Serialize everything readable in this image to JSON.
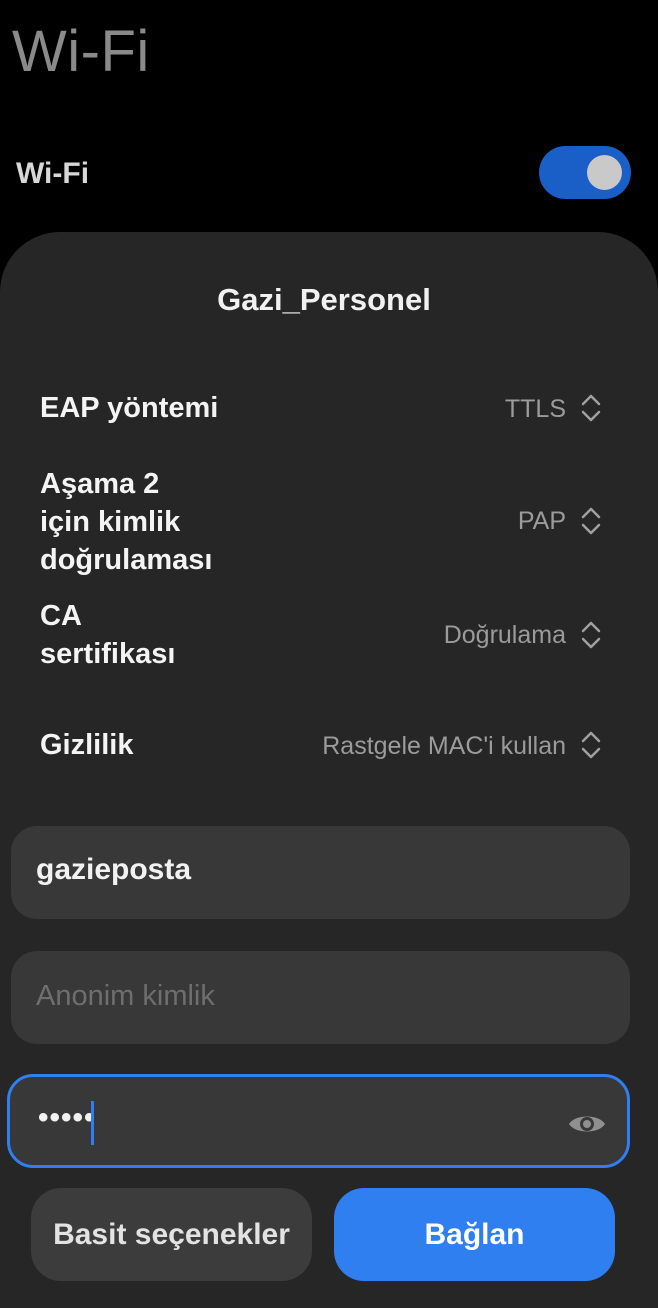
{
  "header": {
    "title": "Wi-Fi",
    "wifi_toggle_label": "Wi-Fi",
    "wifi_enabled": true
  },
  "dialog": {
    "network_name": "Gazi_Personel",
    "settings": [
      {
        "label": "EAP yöntemi",
        "value": "TTLS"
      },
      {
        "label": "Aşama 2\niçin kimlik\ndoğrulaması",
        "value": "PAP"
      },
      {
        "label": "CA\nsertifikası",
        "value": "Doğrulama"
      },
      {
        "label": "Gizlilik",
        "value": "Rastgele MAC'i kullan"
      }
    ],
    "identity_value": "gazieposta",
    "anonymous_identity_placeholder": "Anonim kimlik",
    "password_masked": "•••••",
    "buttons": {
      "simple_options": "Basit seçenekler",
      "connect": "Bağlan"
    }
  },
  "colors": {
    "accent": "#2f7ff0",
    "toggle_on": "#1a5fc8",
    "sheet_bg": "#262626",
    "field_bg": "#383838"
  }
}
